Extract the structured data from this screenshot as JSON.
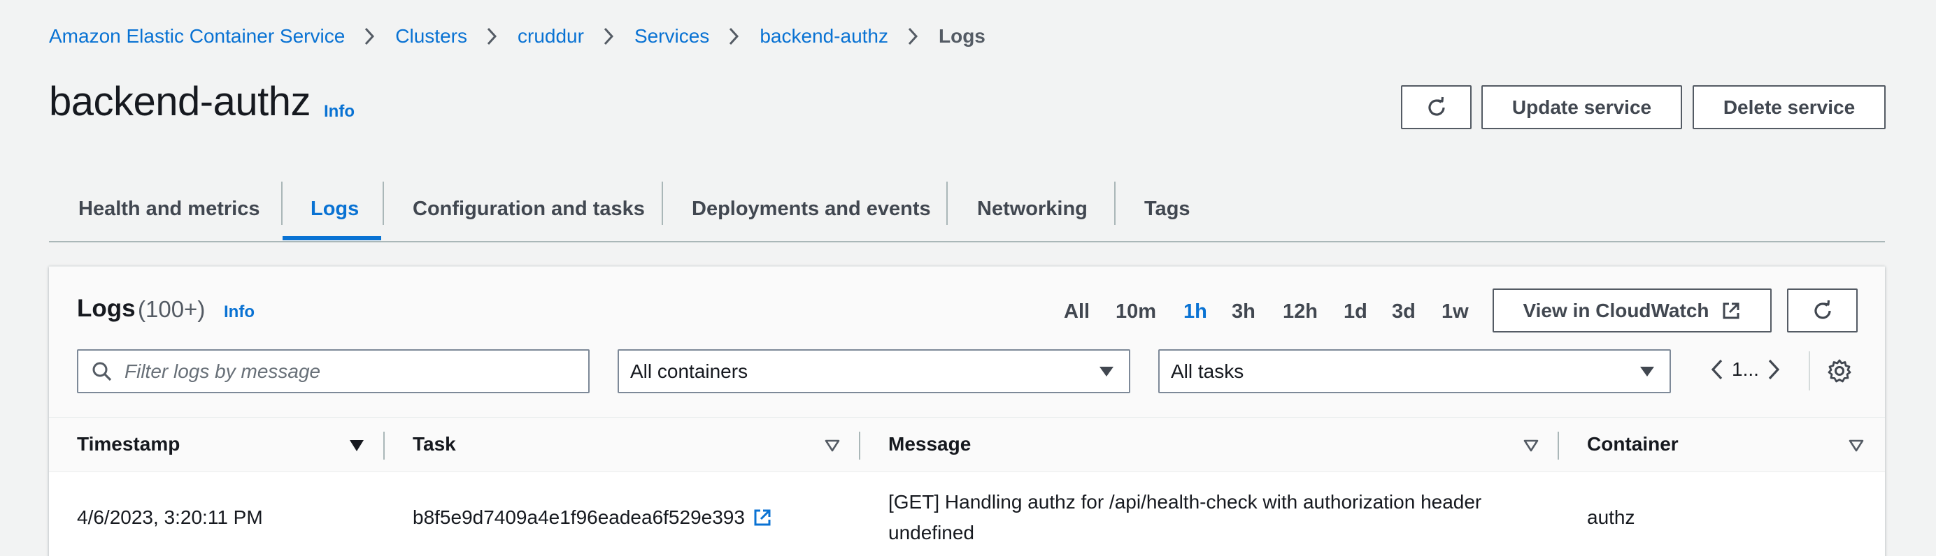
{
  "breadcrumb": {
    "items": [
      "Amazon Elastic Container Service",
      "Clusters",
      "cruddur",
      "Services",
      "backend-authz"
    ],
    "current": "Logs"
  },
  "header": {
    "title": "backend-authz",
    "info": "Info",
    "update_label": "Update service",
    "delete_label": "Delete service"
  },
  "tabs": [
    "Health and metrics",
    "Logs",
    "Configuration and tasks",
    "Deployments and events",
    "Networking",
    "Tags"
  ],
  "logs": {
    "title": "Logs",
    "count": "(100+)",
    "info": "Info",
    "ranges": [
      "All",
      "10m",
      "1h",
      "3h",
      "12h",
      "1d",
      "3d",
      "1w"
    ],
    "active_range": "1h",
    "cloudwatch_label": "View in CloudWatch",
    "filter_placeholder": "Filter logs by message",
    "containers_select": "All containers",
    "tasks_select": "All tasks",
    "page": "1..."
  },
  "table": {
    "columns": [
      "Timestamp",
      "Task",
      "Message",
      "Container"
    ],
    "rows": [
      {
        "timestamp": "4/6/2023, 3:20:11 PM",
        "task": "b8f5e9d7409a4e1f96eadea6f529e393",
        "message_line1": "[GET] Handling authz for /api/health-check with authorization header",
        "message_line2": "undefined",
        "container": "authz"
      }
    ]
  },
  "colors": {
    "link": "#0972d3",
    "background": "#f2f3f3",
    "text": "#16191f"
  }
}
